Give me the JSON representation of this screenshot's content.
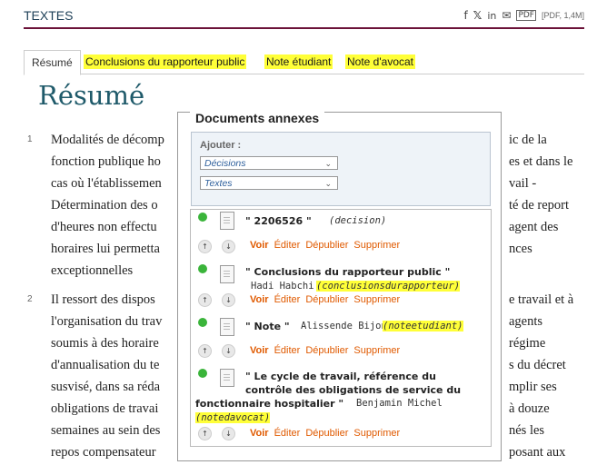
{
  "header": {
    "section_title": "TEXTES",
    "pdf_label": "[PDF, 1,4M]",
    "icons": [
      "facebook-icon",
      "x-icon",
      "linkedin-icon",
      "mail-icon",
      "pdf-icon"
    ]
  },
  "tabs": [
    {
      "label": "Résumé",
      "active": true
    },
    {
      "label": "Conclusions du rapporteur public"
    },
    {
      "label": "Note étudiant"
    },
    {
      "label": "Note d'avocat"
    }
  ],
  "page_title": "Résumé",
  "paragraphs": [
    {
      "num": "1",
      "lines": [
        "Modalités de décomp",
        "fonction publique ho",
        "cas où l'établissemen",
        "Détermination des o",
        "d'heures non effectu",
        "horaires lui permetta",
        "exceptionnelles"
      ],
      "right_lines": [
        "ic de la",
        "es et dans le",
        "vail -",
        "té de report",
        "agent des",
        "nces",
        ""
      ]
    },
    {
      "num": "2",
      "lines": [
        "Il ressort des dispos",
        "l'organisation du trav",
        "soumis à des horaire",
        "d'annualisation du te",
        "susvisé, dans sa réda",
        "obligations de travai",
        "semaines au sein des",
        "repos compensateur"
      ],
      "right_lines": [
        "e travail et à",
        "agents",
        "régime",
        "s du décret",
        "mplir ses",
        "à douze",
        "nés les",
        "posant aux"
      ]
    }
  ],
  "annexes": {
    "title": "Documents annexes",
    "add_label": "Ajouter :",
    "select1": "Décisions",
    "select2": "Textes",
    "items": [
      {
        "title": "\" 2206526 \"",
        "sub": "(decision)",
        "author": ""
      },
      {
        "title": "\" Conclusions du rapporteur public \"",
        "author": "Hadi Habchi",
        "sub": "(conclusionsdurapporteur)"
      },
      {
        "title": "\" Note \"",
        "author": "Alissende Bijon",
        "sub": "(noteetudiant)"
      },
      {
        "title_lines": [
          "\" Le cycle de travail, référence du",
          "contrôle des obligations de service du",
          "fonctionnaire hospitalier \""
        ],
        "author": "Benjamin Michel",
        "sub": "(notedavocat)"
      }
    ],
    "actions": {
      "voir": "Voir",
      "editer": "Éditer",
      "depublier": "Dépublier",
      "supprimer": "Supprimer"
    }
  }
}
